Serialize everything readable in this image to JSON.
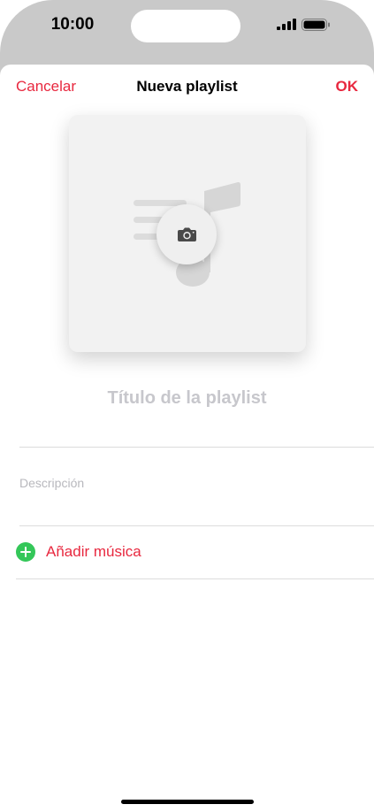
{
  "status_bar": {
    "time": "10:00"
  },
  "nav": {
    "cancel_label": "Cancelar",
    "title": "Nueva playlist",
    "ok_label": "OK"
  },
  "artwork": {
    "icon": "camera-icon"
  },
  "form": {
    "title_placeholder": "Título de la playlist",
    "description_placeholder": "Descripción"
  },
  "actions": {
    "add_music_label": "Añadir música"
  },
  "colors": {
    "accent": "#e8283f",
    "add_icon": "#34c759"
  }
}
